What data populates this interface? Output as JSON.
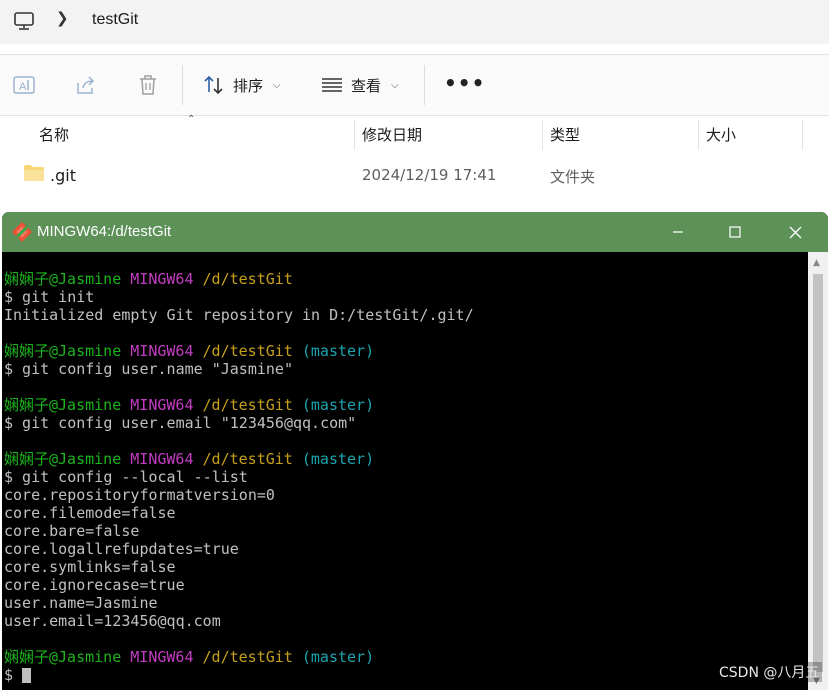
{
  "explorer": {
    "address": {
      "crumb": "testGit"
    },
    "toolbar": {
      "sort_label": "排序",
      "view_label": "查看",
      "more_label": "•••"
    },
    "columns": {
      "name": "名称",
      "date": "修改日期",
      "type": "类型",
      "size": "大小"
    },
    "files": [
      {
        "name": ".git",
        "date": "2024/12/19 17:41",
        "type": "文件夹"
      }
    ]
  },
  "terminal": {
    "title": "MINGW64:/d/testGit",
    "prompt": {
      "user": "娴娴子@Jasmine",
      "system": "MINGW64",
      "path": "/d/testGit",
      "branch": "(master)"
    },
    "commands": [
      "$ git init",
      "$ git config user.name \"Jasmine\"",
      "$ git config user.email \"123456@qq.com\"",
      "$ git config --local --list",
      "$ "
    ],
    "outputs": {
      "init": "Initialized empty Git repository in D:/testGit/.git/",
      "config_list": [
        "core.repositoryformatversion=0",
        "core.filemode=false",
        "core.bare=false",
        "core.logallrefupdates=true",
        "core.symlinks=false",
        "core.ignorecase=true",
        "user.name=Jasmine",
        "user.email=123456@qq.com"
      ]
    },
    "colors": {
      "titlebar": "#5d9158",
      "user": "#1cb41c",
      "system": "#c23cc2",
      "path": "#c5a018",
      "branch": "#1aa4b0",
      "text": "#c0c0c0"
    }
  },
  "watermark": "CSDN @八月五"
}
